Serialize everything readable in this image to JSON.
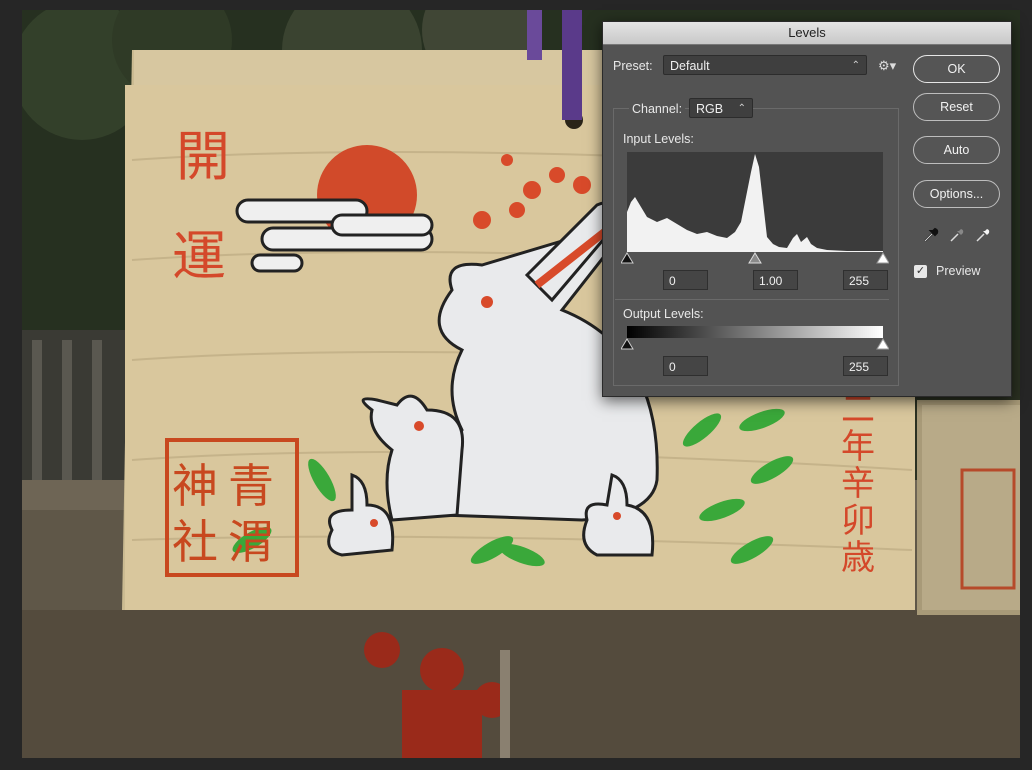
{
  "dialog": {
    "title": "Levels",
    "preset_label": "Preset:",
    "preset_value": "Default",
    "channel_label": "Channel:",
    "channel_value": "RGB",
    "input_levels_label": "Input Levels:",
    "input_black": "0",
    "input_gamma": "1.00",
    "input_white": "255",
    "output_levels_label": "Output Levels:",
    "output_black": "0",
    "output_white": "255",
    "buttons": {
      "ok": "OK",
      "reset": "Reset",
      "auto": "Auto",
      "options": "Options..."
    },
    "preview_label": "Preview",
    "preview_checked": true,
    "icons": [
      "gear-icon",
      "black-eyedropper-icon",
      "gray-eyedropper-icon",
      "white-eyedropper-icon"
    ]
  },
  "photo": {
    "kanji_left_top": "開",
    "kanji_left_bottom": "運",
    "seal_text": [
      "青",
      "渭",
      "神",
      "社"
    ],
    "vertical_text_right": [
      "二",
      "年",
      "辛",
      "卯",
      "歳"
    ]
  },
  "colors": {
    "dialog_bg": "#535353",
    "title_bar": "#d6d6d6",
    "ema_wood": "#e6d2a4",
    "ink_red": "#d84a2a",
    "rabbit_white": "#eeeeee",
    "bamboo_green": "#3aa83a"
  }
}
